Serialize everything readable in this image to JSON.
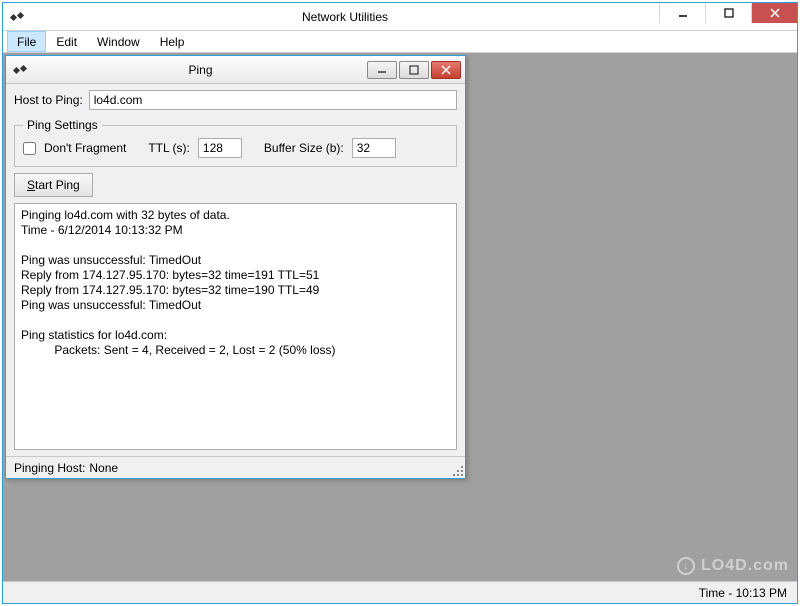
{
  "app": {
    "title": "Network Utilities"
  },
  "menu": {
    "items": [
      "File",
      "Edit",
      "Window",
      "Help"
    ],
    "activeIndex": 0
  },
  "child": {
    "title": "Ping",
    "labels": {
      "host": "Host to Ping:",
      "settingsLegend": "Ping Settings",
      "dontFragment": "Don't Fragment",
      "ttl": "TTL (s):",
      "bufferSize": "Buffer Size (b):"
    },
    "inputs": {
      "host": "lo4d.com",
      "ttl": "128",
      "bufferSize": "32",
      "dontFragment": false
    },
    "buttons": {
      "startPingPrefix": "S",
      "startPingRest": "tart Ping"
    },
    "output": "Pinging lo4d.com with 32 bytes of data.\nTime - 6/12/2014 10:13:32 PM\n\nPing was unsuccessful: TimedOut\nReply from 174.127.95.170: bytes=32 time=191 TTL=51\nReply from 174.127.95.170: bytes=32 time=190 TTL=49\nPing was unsuccessful: TimedOut\n\nPing statistics for lo4d.com:\n          Packets: Sent = 4, Received = 2, Lost = 2 (50% loss)",
    "status": {
      "label": "Pinging Host:",
      "value": "None"
    }
  },
  "mainStatus": {
    "time": "Time - 10:13 PM"
  },
  "watermark": "LO4D.com"
}
